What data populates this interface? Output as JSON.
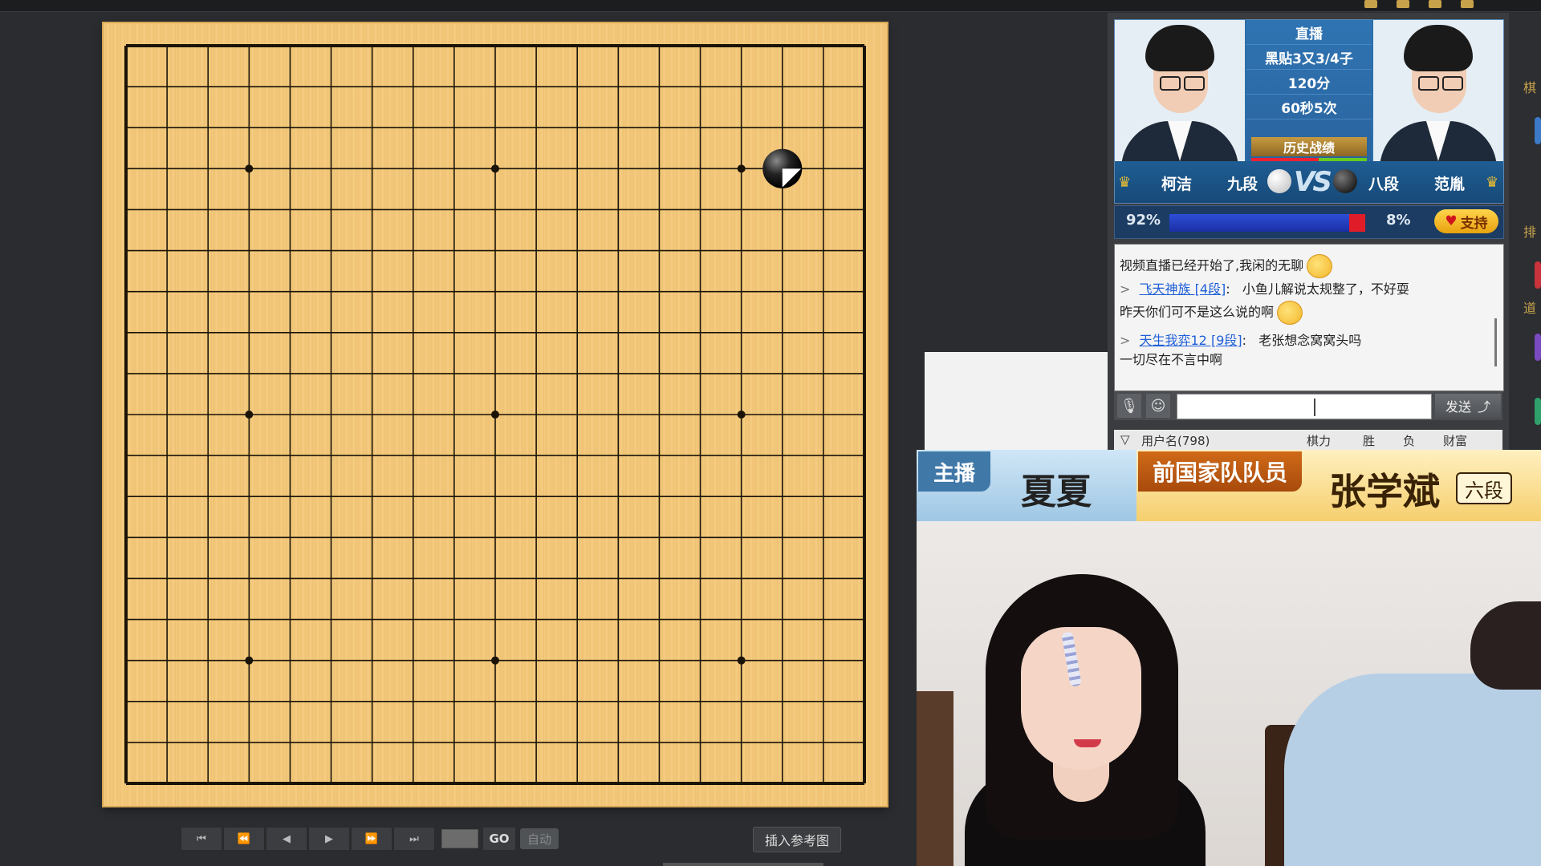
{
  "controls": {
    "first": "⏮",
    "prev_fast": "⏪",
    "prev": "◀",
    "play": "▶",
    "next_fast": "⏩",
    "last": "⏭",
    "go": "GO",
    "auto": "自动",
    "insert_ref": "插入参考图"
  },
  "board": {
    "size": 19,
    "stones": [
      {
        "color": "black",
        "col": 16,
        "row": 3
      }
    ]
  },
  "match": {
    "status": "直播",
    "komi": "黑贴3又3/4子",
    "time": "120分",
    "byoyomi": "60秒5次",
    "history_label": "历史战绩",
    "left_player": {
      "name": "柯洁",
      "rank": "九段"
    },
    "right_player": {
      "name": "范胤",
      "rank": "八段"
    },
    "vs": "VS",
    "left_pct": "92%",
    "right_pct": "8%",
    "left_pct_value": 92,
    "support_label": "支持"
  },
  "chat": {
    "messages": [
      {
        "text": "视频直播已经开始了,我闲的无聊",
        "emoji": true
      },
      {
        "user": "飞天神族 [4段]",
        "text": "小鱼儿解说太规整了，不好耍"
      },
      {
        "text": "昨天你们可不是这么说的啊",
        "emoji": true
      },
      {
        "user": "天生我弈12 [9段]",
        "text": "老张想念窝窝头吗"
      },
      {
        "text": "一切尽在不言中啊"
      }
    ],
    "send_label": "发送"
  },
  "user_table": {
    "headers": [
      "用户名(798)",
      "棋力",
      "胜",
      "负",
      "财富"
    ]
  },
  "banner": {
    "host_tag": "主播",
    "host_name": "夏夏",
    "guest_tag": "前国家队队员",
    "guest_name": "张学斌",
    "guest_rank": "六段"
  },
  "colors": {
    "board": "#f3c97c",
    "panel_blue": "#2b6fa8",
    "support_gold": "#ffd44c"
  }
}
